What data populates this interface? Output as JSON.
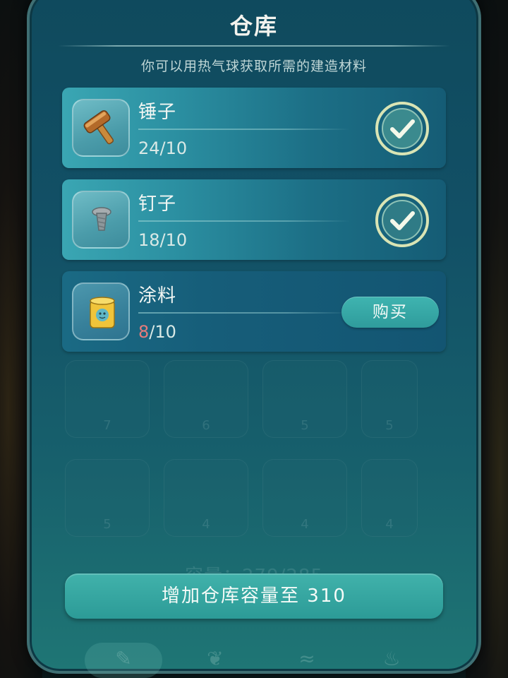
{
  "panel": {
    "title": "仓库",
    "subtitle": "你可以用热气球获取所需的建造材料"
  },
  "materials": [
    {
      "name": "锤子",
      "have": "24",
      "need": "/10",
      "status": "complete",
      "icon": "hammer-icon"
    },
    {
      "name": "钉子",
      "have": "18",
      "need": "/10",
      "status": "complete",
      "icon": "nail-icon"
    },
    {
      "name": "涂料",
      "have": "8",
      "need": "/10",
      "status": "insufficient",
      "icon": "paint-bucket-icon",
      "action_label": "购买"
    }
  ],
  "background_grid": {
    "row1_counts": [
      "7",
      "6",
      "5",
      "5"
    ],
    "row2_counts": [
      "5",
      "4",
      "4",
      "4"
    ],
    "capacity_text": "容量：279/285"
  },
  "footer": {
    "upgrade_label": "增加仓库容量至 310"
  },
  "colors": {
    "accent": "#2f9c9c",
    "panel": "#125066",
    "insufficient": "#e57b7b",
    "check": "#e8f0c8"
  }
}
